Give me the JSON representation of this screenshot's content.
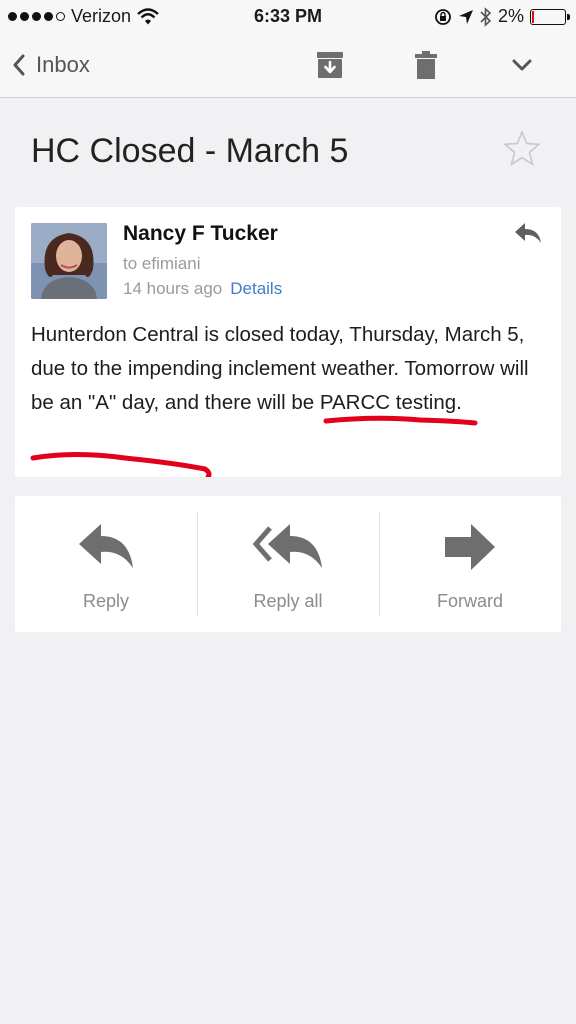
{
  "status_bar": {
    "carrier": "Verizon",
    "time": "6:33 PM",
    "battery": "2%",
    "battery_level": 0.02,
    "icons": [
      "signal-icon",
      "wifi-icon",
      "rotation-lock-icon",
      "location-icon",
      "bluetooth-icon",
      "battery-icon"
    ]
  },
  "nav": {
    "back_label": "Inbox",
    "icons": [
      "chevron-left-icon",
      "archive-icon",
      "trash-icon",
      "chevron-down-icon"
    ]
  },
  "email": {
    "subject": "HC Closed - March 5",
    "star_icon": "star-outline-icon",
    "sender": "Nancy F Tucker",
    "recipient": "to efimiani",
    "time": "14 hours ago",
    "details_link": "Details",
    "body": "Hunterdon Central is closed today, Thursday, March 5, due to the impending inclement weather. Tomorrow will be an \"A\" day, and there will be PARCC testing.",
    "annotation_color": "#e3001b"
  },
  "actions": [
    {
      "label": "Reply",
      "icon": "reply-icon"
    },
    {
      "label": "Reply all",
      "icon": "reply-all-icon"
    },
    {
      "label": "Forward",
      "icon": "forward-icon"
    }
  ],
  "colors": {
    "background": "#f1f0f3",
    "link": "#3f7cc7",
    "icon_gray": "#6e6e6e"
  }
}
